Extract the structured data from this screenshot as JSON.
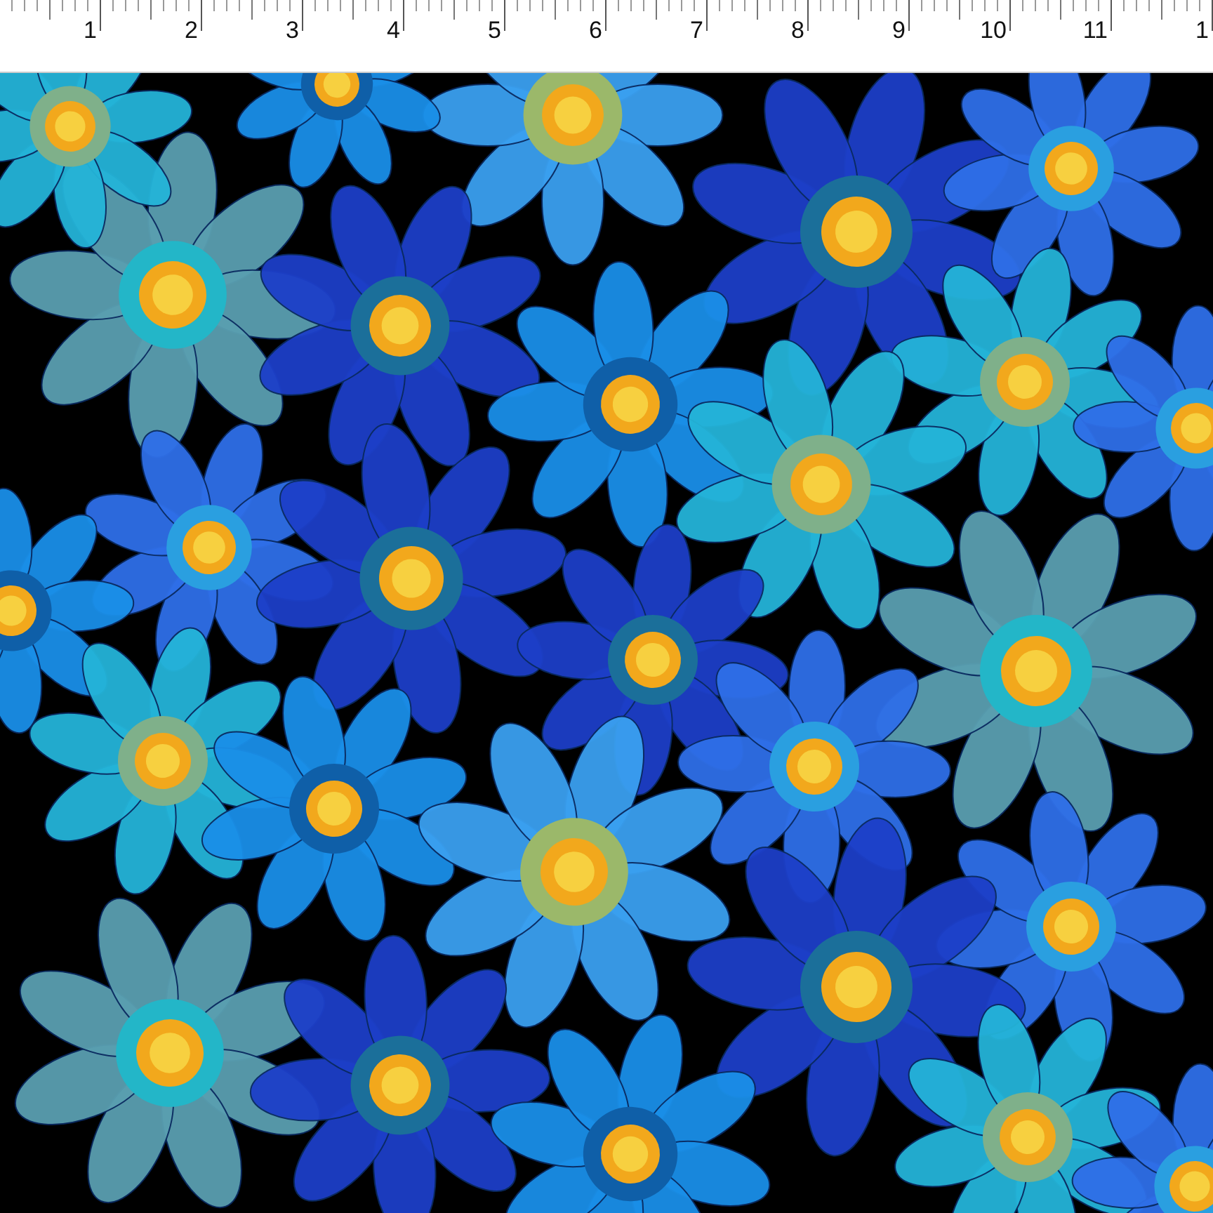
{
  "ruler": {
    "labels": [
      "1",
      "2",
      "3",
      "4",
      "5",
      "6",
      "7",
      "8",
      "9",
      "10",
      "11",
      "1"
    ]
  }
}
